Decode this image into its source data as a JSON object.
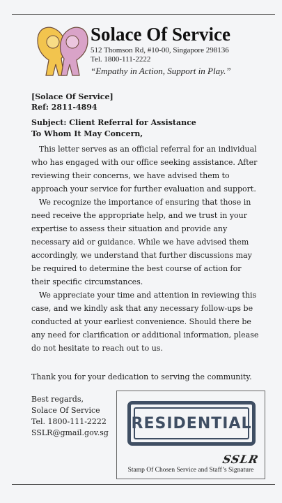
{
  "letterhead": {
    "org_name": "Solace Of Service",
    "address": "512 Thomson Rd, #10-00, Singapore 298136",
    "tel": "Tel. 1800-111-2222",
    "tagline": "“Empathy in Action, Support in Play.”",
    "logo_colors": {
      "left_figure": "#f2c44e",
      "right_figure": "#d9a3c8",
      "outline": "#6b4a3a"
    }
  },
  "letter": {
    "sender": "[Solace Of Service]",
    "ref": "Ref: 2811-4894",
    "subject": "Subject: Client Referral for Assistance",
    "salutation": "To Whom It May Concern,",
    "paragraphs": [
      "This letter serves as an official referral for an individual who has engaged with our office seeking assistance. After reviewing their concerns, we have advised them to approach your service for further evaluation and support.",
      "We recognize the importance of ensuring that those in need receive the appropriate help, and we trust in your expertise to assess their situation and provide any necessary aid or guidance. While we have advised them accordingly, we understand that further discussions may be required to determine the best course of action for their specific circumstances.",
      "We appreciate your time and attention in reviewing this case, and we kindly ask that any necessary follow-ups be conducted at your earliest convenience. Should there be any need for clarification or additional information, please do not hesitate to reach out to us."
    ],
    "thanks": "Thank you for your dedication to serving the community.",
    "closing": {
      "regards": "Best regards,",
      "org": "Solace Of Service",
      "tel": "Tel. 1800-111-2222",
      "email": "SSLR@gmail.gov.sg"
    }
  },
  "stamp": {
    "text": "RESIDENTIAL",
    "signature": "SSLR",
    "caption": "Stamp Of Chosen Service and Staff’s Signature",
    "color": "#3f4e63"
  }
}
